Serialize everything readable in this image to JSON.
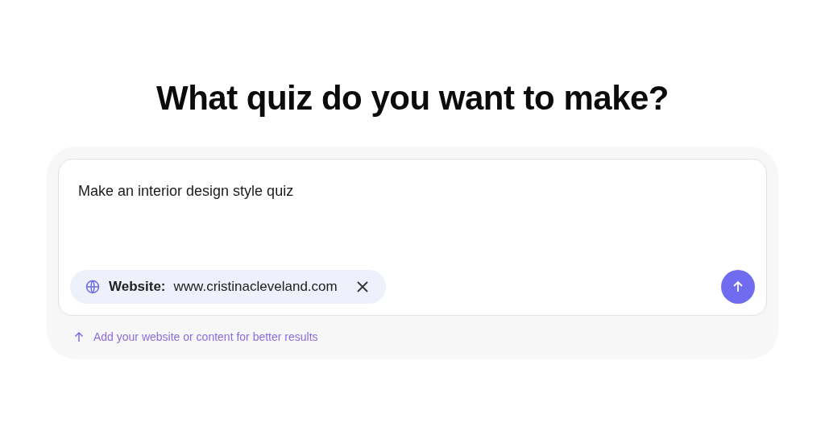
{
  "heading": "What quiz do you want to make?",
  "prompt": {
    "value": "Make an interior design style quiz"
  },
  "source_chip": {
    "label": "Website:",
    "value": "www.cristinacleveland.com"
  },
  "hint": "Add your website or content for better results"
}
